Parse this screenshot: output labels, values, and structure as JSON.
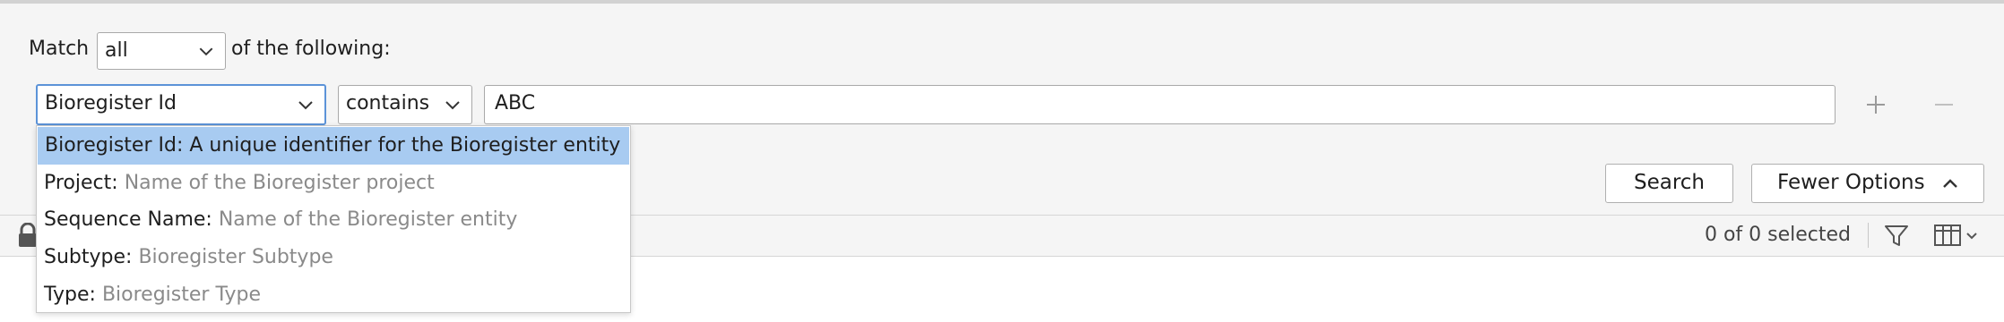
{
  "filter": {
    "match_prefix": "Match",
    "match_value": "all",
    "match_suffix": "of the following:"
  },
  "condition": {
    "field": "Bioregister Id",
    "operator": "contains",
    "value": "ABC"
  },
  "buttons": {
    "search": "Search",
    "fewer_options": "Fewer Options"
  },
  "results": {
    "selected_count": "0 of 0 selected"
  },
  "field_options": [
    {
      "name": "Bioregister Id:",
      "desc": "A unique identifier for the Bioregister entity",
      "selected": true
    },
    {
      "name": "Project:",
      "desc": "Name of the Bioregister project"
    },
    {
      "name": "Sequence Name:",
      "desc": "Name of the Bioregister entity"
    },
    {
      "name": "Subtype:",
      "desc": "Bioregister Subtype"
    },
    {
      "name": "Type:",
      "desc": "Bioregister Type"
    }
  ],
  "colors": {
    "selection": "#a8cbf1",
    "focus": "#5c93d8"
  }
}
